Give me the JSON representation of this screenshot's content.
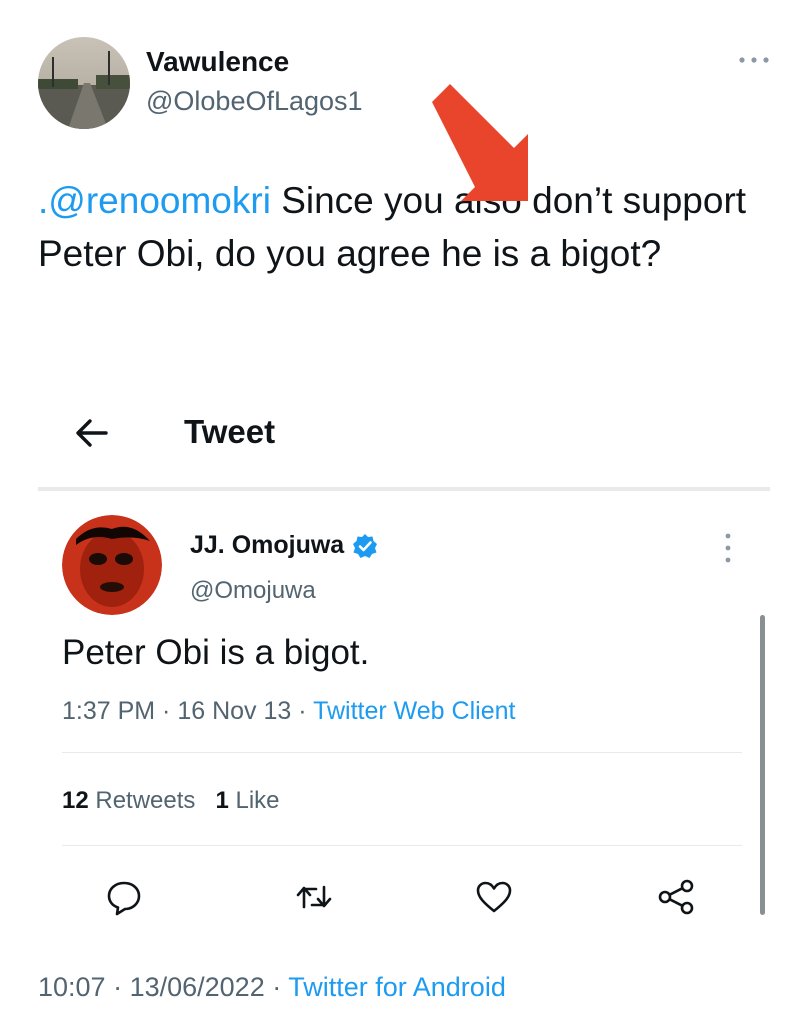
{
  "tweet": {
    "author_name": "Vawulence",
    "author_handle": "@OlobeOfLagos1",
    "mention": ".@renoomokri",
    "body": " Since you also don’t support Peter Obi, do you agree he is a bigot?",
    "time": "10:07",
    "date": "13/06/2022",
    "separator": " · ",
    "client": "Twitter for Android"
  },
  "embedded": {
    "header_title": "Tweet",
    "author_name": "JJ. Omojuwa",
    "author_handle": "@Omojuwa",
    "text": "Peter Obi is a bigot.",
    "time": "1:37 PM",
    "date": "16 Nov 13",
    "separator": " · ",
    "client": "Twitter Web Client",
    "retweets_count": "12",
    "retweets_label": " Retweets",
    "likes_count": "1",
    "likes_label": " Like"
  },
  "icons": {
    "more": "more-horizontal-icon",
    "back": "arrow-left-icon",
    "verified": "verified-badge-icon",
    "reply": "reply-icon",
    "retweet": "retweet-icon",
    "like": "heart-icon",
    "share": "share-icon",
    "annotation": "red-arrow-icon"
  },
  "colors": {
    "link": "#1d9bf0",
    "text": "#0f1419",
    "secondary": "#536471",
    "annotation": "#e8452c"
  }
}
